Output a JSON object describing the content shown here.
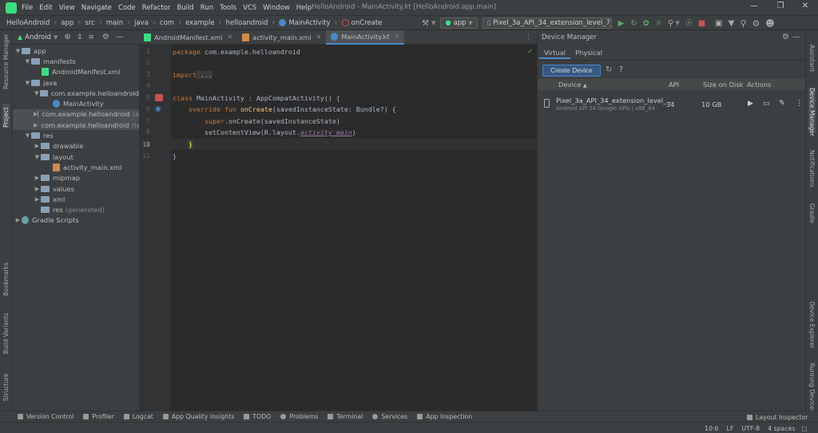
{
  "menu": {
    "items": [
      "File",
      "Edit",
      "View",
      "Navigate",
      "Code",
      "Refactor",
      "Build",
      "Run",
      "Tools",
      "VCS",
      "Window",
      "Help"
    ],
    "window_title": "HelloAndroid - MainActivity.kt [HelloAndroid.app.main]"
  },
  "breadcrumb": {
    "items": [
      "HelloAndroid",
      "app",
      "src",
      "main",
      "java",
      "com",
      "example",
      "helloandroid",
      "MainActivity",
      "onCreate"
    ]
  },
  "toolbar": {
    "config": "app",
    "device": "Pixel_3a_API_34_extension_level_7_x8..."
  },
  "side_tools": {
    "left": [
      "Resource Manager",
      "Project",
      "Bookmarks",
      "Build Variants",
      "Structure"
    ],
    "right": [
      "Assistant",
      "Device Manager",
      "Notifications",
      "Gradle",
      "Device Explorer",
      "Running Devices"
    ]
  },
  "project": {
    "view_label": "Android",
    "tree": [
      {
        "label": "app",
        "suffix": ""
      },
      {
        "label": "manifests",
        "suffix": ""
      },
      {
        "label": "AndroidManifest.xml",
        "suffix": ""
      },
      {
        "label": "java",
        "suffix": ""
      },
      {
        "label": "com.example.helloandroid",
        "suffix": ""
      },
      {
        "label": "MainActivity",
        "suffix": ""
      },
      {
        "label": "com.example.helloandroid",
        "suffix": "(a"
      },
      {
        "label": "com.example.helloandroid",
        "suffix": "(te"
      },
      {
        "label": "res",
        "suffix": ""
      },
      {
        "label": "drawable",
        "suffix": ""
      },
      {
        "label": "layout",
        "suffix": ""
      },
      {
        "label": "activity_main.xml",
        "suffix": ""
      },
      {
        "label": "mipmap",
        "suffix": ""
      },
      {
        "label": "values",
        "suffix": ""
      },
      {
        "label": "xml",
        "suffix": ""
      },
      {
        "label": "res",
        "suffix": "(generated)"
      },
      {
        "label": "Gradle Scripts",
        "suffix": ""
      }
    ]
  },
  "editor": {
    "tabs": [
      "AndroidManifest.xml",
      "activity_main.xml",
      "MainActivity.kt"
    ],
    "line_numbers": [
      "1",
      "2",
      "3",
      "4",
      "5",
      "6",
      "7",
      "8",
      "9",
      "10",
      "11"
    ],
    "code": {
      "l1_kw": "package",
      "l1_rest": " com.example.helloandroid",
      "l3_kw": "import",
      "l3_rest": " ...",
      "l6_kw": "class",
      "l6_rest": " MainActivity : AppCompatActivity() {",
      "l7_kw": "override fun",
      "l7_fn": "onCreate",
      "l7_rest": "(savedInstanceState: Bundle?) {",
      "l8_kw": "super",
      "l8_rest": ".onCreate(savedInstanceState)",
      "l9_pre": "setContentView(R.layout.",
      "l9_it": "activity_main",
      "l9_post": ")",
      "l10": "}",
      "l11": "}"
    }
  },
  "device_manager": {
    "title": "Device Manager",
    "tabs": [
      "Virtual",
      "Physical"
    ],
    "create_button": "Create Device",
    "help_glyph": "?",
    "columns": [
      "Device",
      "API",
      "Size on Disk",
      "Actions"
    ],
    "devices": [
      {
        "name": "Pixel_3a_API_34_extension_level_...",
        "details": "Android API 34 Google APIs | x86_64",
        "api": "34",
        "size": "10 GB"
      }
    ]
  },
  "bottom_tools": [
    "Version Control",
    "Profiler",
    "Logcat",
    "App Quality Insights",
    "TODO",
    "Problems",
    "Terminal",
    "Services",
    "App Inspection"
  ],
  "layout_inspector": "Layout Inspector",
  "status": {
    "position": "10:6",
    "line_sep": "LF",
    "encoding": "UTF-8",
    "indent": "4 spaces"
  }
}
